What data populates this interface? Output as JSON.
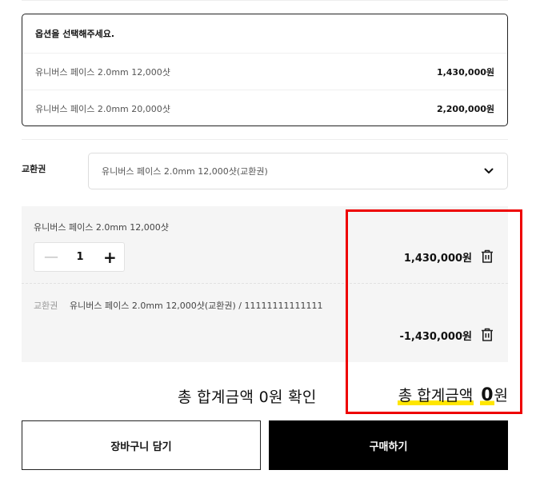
{
  "options": {
    "header": "옵션을 선택해주세요.",
    "items": [
      {
        "name": "유니버스 페이스 2.0mm 12,000샷",
        "price": "1,430,000원"
      },
      {
        "name": "유니버스 페이스 2.0mm 20,000샷",
        "price": "2,200,000원"
      }
    ]
  },
  "exchange": {
    "label": "교환권",
    "selected": "유니버스 페이스 2.0mm 12,000샷(교환권)",
    "icon": "chevron-down-icon"
  },
  "selected_items": [
    {
      "name": "유니버스 페이스 2.0mm 12,000샷",
      "quantity": "1",
      "price": "1,430,000원"
    },
    {
      "tag": "교환권",
      "name": "유니버스 페이스 2.0mm 12,000샷(교환권) / 11111111111111",
      "price": "-1,430,000원"
    }
  ],
  "caption": "총 합계금액 0원 확인",
  "total": {
    "label": "총 합계금액",
    "amount": "0",
    "unit": "원"
  },
  "buttons": {
    "cart": "장바구니 담기",
    "buy": "구매하기"
  },
  "colors": {
    "highlight": "#ffe600",
    "annotation_box": "#ee0000",
    "buy_button": "#000000"
  }
}
